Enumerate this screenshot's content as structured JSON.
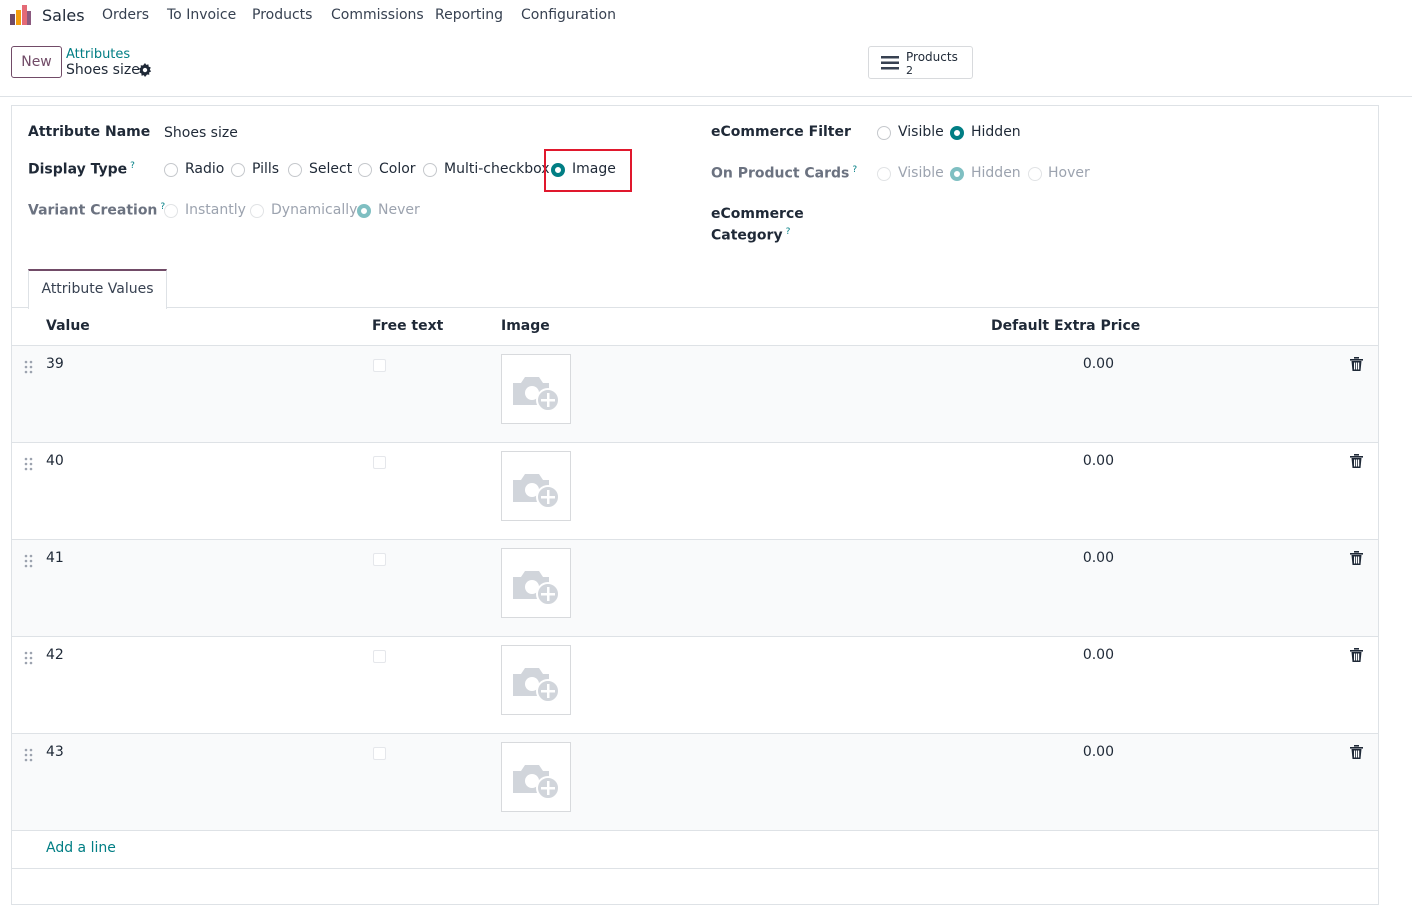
{
  "nav": {
    "app_name": "Sales",
    "menu": [
      "Orders",
      "To Invoice",
      "Products",
      "Commissions",
      "Reporting",
      "Configuration"
    ]
  },
  "control_panel": {
    "new_label": "New",
    "breadcrumb_parent": "Attributes",
    "breadcrumb_current": "Shoes size",
    "smart_button": {
      "label": "Products",
      "count": "2"
    }
  },
  "form": {
    "attribute_name_label": "Attribute Name",
    "attribute_name_value": "Shoes size",
    "display_type_label": "Display Type",
    "display_type_options": [
      "Radio",
      "Pills",
      "Select",
      "Color",
      "Multi-checkbox",
      "Image"
    ],
    "display_type_selected": "Image",
    "variant_creation_label": "Variant Creation",
    "variant_creation_options": [
      "Instantly",
      "Dynamically",
      "Never"
    ],
    "variant_creation_selected": "Never",
    "ecommerce_filter_label": "eCommerce Filter",
    "ecommerce_filter_options": [
      "Visible",
      "Hidden"
    ],
    "ecommerce_filter_selected": "Hidden",
    "product_cards_label": "On Product Cards",
    "product_cards_options": [
      "Visible",
      "Hidden",
      "Hover"
    ],
    "product_cards_selected": "Hidden",
    "ecommerce_category_label_1": "eCommerce",
    "ecommerce_category_label_2": "Category",
    "help_mark": "?"
  },
  "tab": {
    "label": "Attribute Values"
  },
  "table": {
    "headers": {
      "value": "Value",
      "free_text": "Free text",
      "image": "Image",
      "price": "Default Extra Price"
    },
    "rows": [
      {
        "value": "39",
        "price": "0.00"
      },
      {
        "value": "40",
        "price": "0.00"
      },
      {
        "value": "41",
        "price": "0.00"
      },
      {
        "value": "42",
        "price": "0.00"
      },
      {
        "value": "43",
        "price": "0.00"
      }
    ],
    "add_line": "Add a line"
  },
  "colors": {
    "accent": "#017e84",
    "brand": "#714b67",
    "highlight": "#e0182d"
  }
}
